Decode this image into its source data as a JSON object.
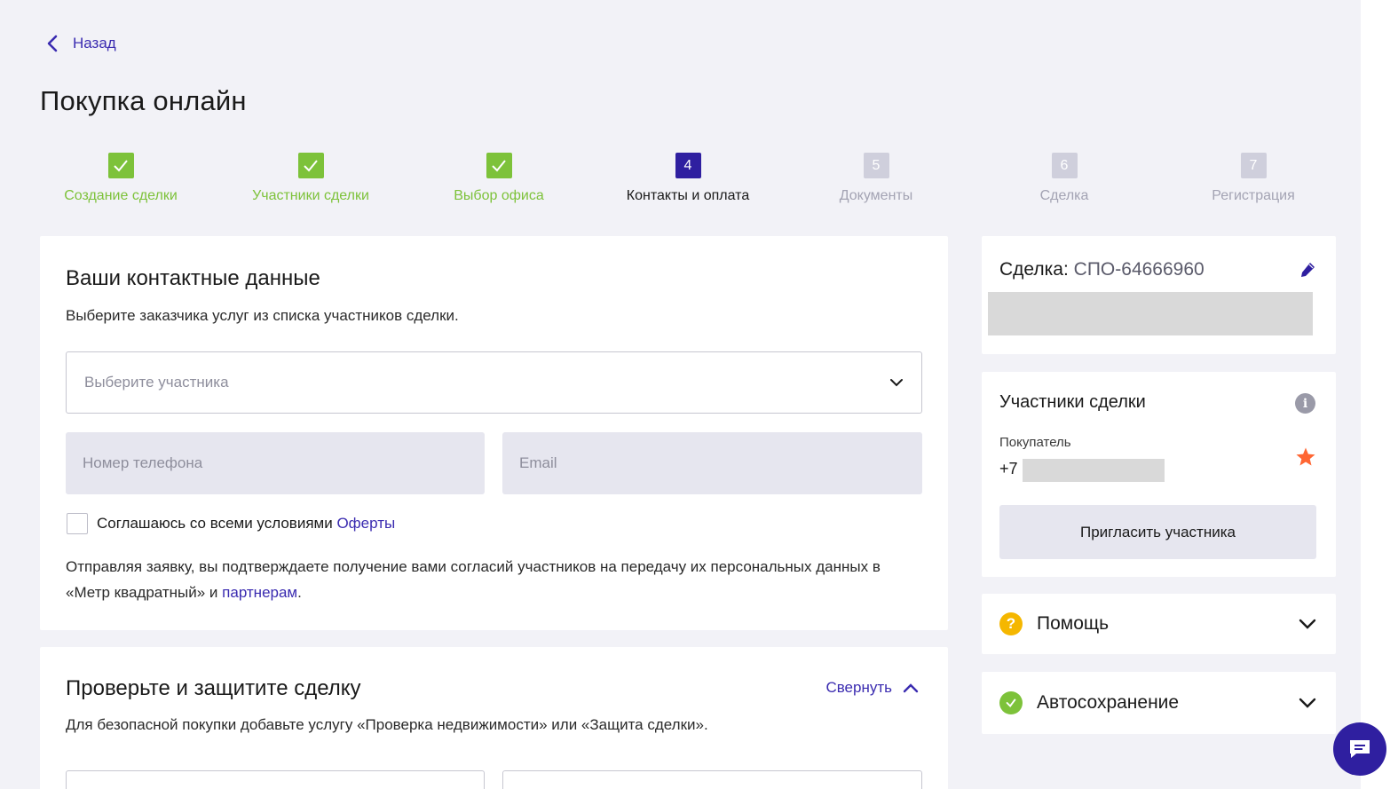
{
  "nav": {
    "back_label": "Назад"
  },
  "page_title": "Покупка онлайн",
  "steps": [
    {
      "num": "1",
      "label": "Создание сделки",
      "state": "done"
    },
    {
      "num": "2",
      "label": "Участники сделки",
      "state": "done"
    },
    {
      "num": "3",
      "label": "Выбор офиса",
      "state": "done"
    },
    {
      "num": "4",
      "label": "Контакты и оплата",
      "state": "active"
    },
    {
      "num": "5",
      "label": "Документы",
      "state": "pending"
    },
    {
      "num": "6",
      "label": "Сделка",
      "state": "pending"
    },
    {
      "num": "7",
      "label": "Регистрация",
      "state": "pending"
    }
  ],
  "contacts": {
    "title": "Ваши контактные данные",
    "subtitle": "Выберите заказчика услуг из списка участников сделки.",
    "select_placeholder": "Выберите участника",
    "phone_placeholder": "Номер телефона",
    "email_placeholder": "Email",
    "agree_text": "Соглашаюсь со всеми условиями",
    "agree_link": "Оферты",
    "consent_text": "Отправляя заявку, вы подтверждаете получение вами согласий участников на передачу их персональных данных в «Метр квадратный» и",
    "consent_link": "партнерам",
    "consent_end": "."
  },
  "protect": {
    "title": "Проверьте и защитите сделку",
    "collapse_label": "Свернуть",
    "subtitle": "Для безопасной покупки добавьте услугу «Проверка недвижимости» или «Защита сделки»."
  },
  "deal": {
    "label": "Сделка:",
    "number": "СПО-64666960"
  },
  "participants": {
    "title": "Участники сделки",
    "role": "Покупатель",
    "phone_prefix": "+7",
    "invite_label": "Пригласить участника"
  },
  "help": {
    "label": "Помощь"
  },
  "autosave": {
    "label": "Автосохранение"
  },
  "colors": {
    "accent": "#2f1fa0",
    "done": "#7dc23a",
    "pending": "#cfcfdc",
    "star": "#ff6633",
    "help": "#f5b700"
  }
}
